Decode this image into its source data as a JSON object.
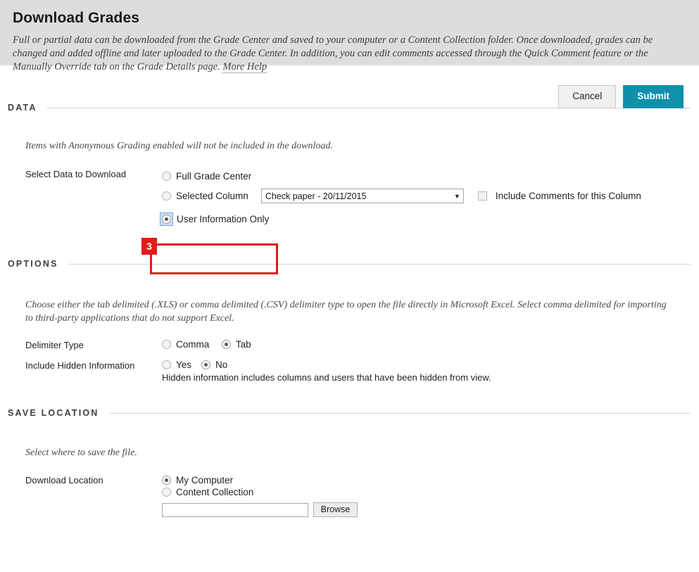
{
  "header": {
    "title": "Download Grades",
    "description": "Full or partial data can be downloaded from the Grade Center and saved to your computer or a Content Collection folder. Once downloaded, grades can be changed and added offline and later uploaded to the Grade Center. In addition, you can edit comments accessed through the Quick Comment feature or the Manually Override tab on the Grade Details page.",
    "more_help": "More Help",
    "background_color": "#dddddd"
  },
  "actions": {
    "cancel_label": "Cancel",
    "submit_label": "Submit",
    "submit_color": "#0f90ad"
  },
  "sections": {
    "data": {
      "title": "DATA",
      "help": "Items with Anonymous Grading enabled will not be included in the download.",
      "field_label": "Select Data to Download",
      "options": [
        {
          "label": "Full Grade Center",
          "checked": false
        },
        {
          "label": "Selected Column",
          "checked": false
        },
        {
          "label": "User Information Only",
          "checked": true
        }
      ],
      "column_select": {
        "value": "Check paper - 20/11/2015",
        "arrow": "▼"
      },
      "include_comments": {
        "label": "Include Comments for this Column",
        "checked": false
      }
    },
    "options": {
      "title": "OPTIONS",
      "help": "Choose either the tab delimited (.XLS) or comma delimited (.CSV) delimiter type to open the file directly in Microsoft Excel. Select comma delimited for importing to third-party applications that do not support Excel.",
      "delimiter": {
        "label": "Delimiter Type",
        "options": [
          {
            "label": "Comma",
            "checked": false
          },
          {
            "label": "Tab",
            "checked": true
          }
        ]
      },
      "hidden_info": {
        "label": "Include Hidden Information",
        "options": [
          {
            "label": "Yes",
            "checked": false
          },
          {
            "label": "No",
            "checked": true
          }
        ],
        "note": "Hidden information includes columns and users that have been hidden from view."
      }
    },
    "save_location": {
      "title": "SAVE LOCATION",
      "help": "Select where to save the file.",
      "field_label": "Download Location",
      "options": [
        {
          "label": "My Computer",
          "checked": true
        },
        {
          "label": "Content Collection",
          "checked": false
        }
      ],
      "path_value": "",
      "path_placeholder": "",
      "browse_label": "Browse"
    }
  },
  "annotation": {
    "step_number": "3",
    "color": "#e01b1b"
  }
}
